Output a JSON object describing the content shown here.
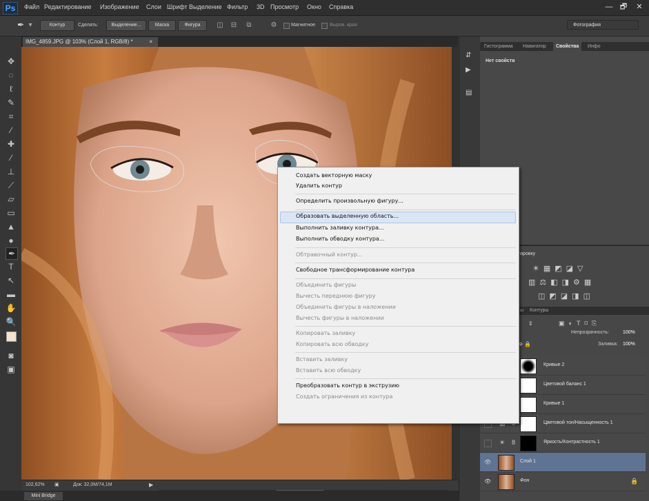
{
  "menu": {
    "logo": "Ps",
    "items": [
      "Файл",
      "Редактирование",
      "Изображение",
      "Слои",
      "Шрифт",
      "Выделение",
      "Фильтр",
      "3D",
      "Просмотр",
      "Окно",
      "Справка"
    ]
  },
  "window_controls": {
    "minimize": "—",
    "restore": "🗗",
    "close": "✕"
  },
  "options": {
    "mode": "Контур",
    "make_label": "Сделать:",
    "selection_btn": "Выделение...",
    "mask_btn": "Маска",
    "shape_btn": "Фигура",
    "rubber_band_label": "Магнитное",
    "align_edges_label": "Выров. края",
    "workspace": "Фотография"
  },
  "document": {
    "tab_title": "IMG_4859.JPG @ 103% (Слой 1, RGB/8) *",
    "tab_close": "×",
    "zoom": "102,62%",
    "doc_size": "Док: 32,0M/74,1M"
  },
  "mini_bridge": "Mini Bridge",
  "panels": {
    "top_tabs": [
      "Гистограмма",
      "Навигатор",
      "Свойства",
      "Инфо"
    ],
    "active_top_tab": "Свойства",
    "no_properties": "Нет свойств",
    "adjustments_title": "рректировку",
    "layers_tabs": [
      "ы",
      "Контуры"
    ],
    "opacity_label": "Непрозрачность:",
    "opacity_value": "100%",
    "fill_label": "Заливка:",
    "fill_value": "100%"
  },
  "layers": [
    {
      "name": "Кривые 2",
      "thumb": "#111"
    },
    {
      "name": "Цветовой баланс 1",
      "thumb": "#fff"
    },
    {
      "name": "Кривые 1",
      "thumb": "#fff"
    },
    {
      "name": "Цветовой тон/Насыщенность 1",
      "thumb": "#fff"
    },
    {
      "name": "Яркость/Контрастность 1",
      "thumb": "#000"
    },
    {
      "name": "Слой 1",
      "thumb": "photo",
      "selected": true
    },
    {
      "name": "Фон",
      "thumb": "photo"
    }
  ],
  "context_menu": {
    "items": [
      {
        "label": "Создать векторную маску",
        "enabled": true
      },
      {
        "label": "Удалить контур",
        "enabled": true
      },
      {
        "label": "Определить произвольную фигуру...",
        "enabled": true
      },
      {
        "label": "Образовать выделенную область...",
        "enabled": true,
        "highlighted": true
      },
      {
        "label": "Выполнить заливку контура...",
        "enabled": true
      },
      {
        "label": "Выполнить обводку контура...",
        "enabled": true
      },
      {
        "label": "Обтравочный контур...",
        "enabled": false
      },
      {
        "label": "Свободное трансформирование контура",
        "enabled": true
      },
      {
        "label": "Объединить фигуры",
        "enabled": false
      },
      {
        "label": "Вычесть переднюю фигуру",
        "enabled": false
      },
      {
        "label": "Объединить фигуры в наложении",
        "enabled": false
      },
      {
        "label": "Вычесть фигуры в наложении",
        "enabled": false
      },
      {
        "label": "Копировать заливку",
        "enabled": false
      },
      {
        "label": "Копировать всю обводку",
        "enabled": false
      },
      {
        "label": "Вставить заливку",
        "enabled": false
      },
      {
        "label": "Вставить всю обводку",
        "enabled": false
      },
      {
        "label": "Преобразовать контур в экструзию",
        "enabled": true
      },
      {
        "label": "Создать ограничения из контура",
        "enabled": false
      }
    ]
  },
  "colors": {
    "accent": "#5f7393",
    "highlight": "#dbe6f4",
    "skin": "#e7b59a",
    "hair": "#b8682f"
  }
}
